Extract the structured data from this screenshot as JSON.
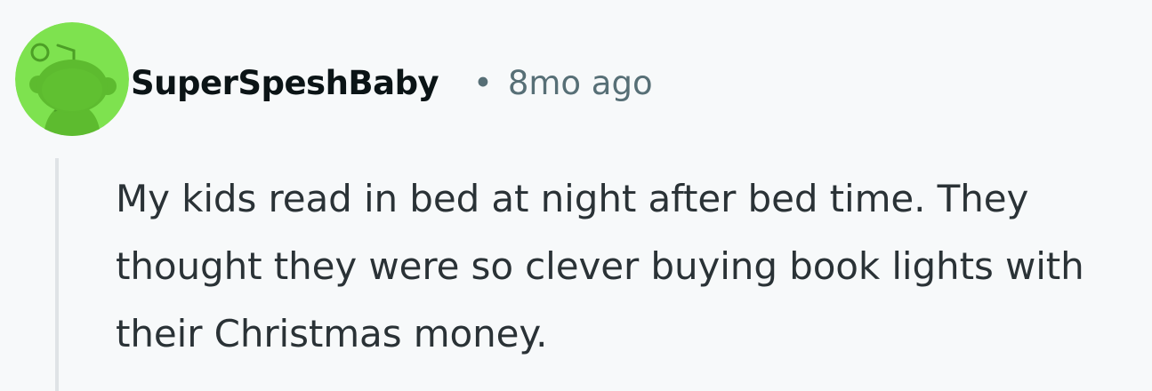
{
  "comment": {
    "author": "SuperSpeshBaby",
    "separator": "•",
    "timestamp": "8mo ago",
    "avatar_icon": "snoo-avatar-icon",
    "avatar_color": "#7ee24f",
    "body": "My kids read in bed at night after bed time. They thought they were so clever buying book lights with their Christmas money."
  },
  "colors": {
    "background": "#f7f9fa",
    "username": "#0b1416",
    "meta": "#576f76",
    "body": "#2a3236",
    "thread_line": "#dfe3e6"
  }
}
